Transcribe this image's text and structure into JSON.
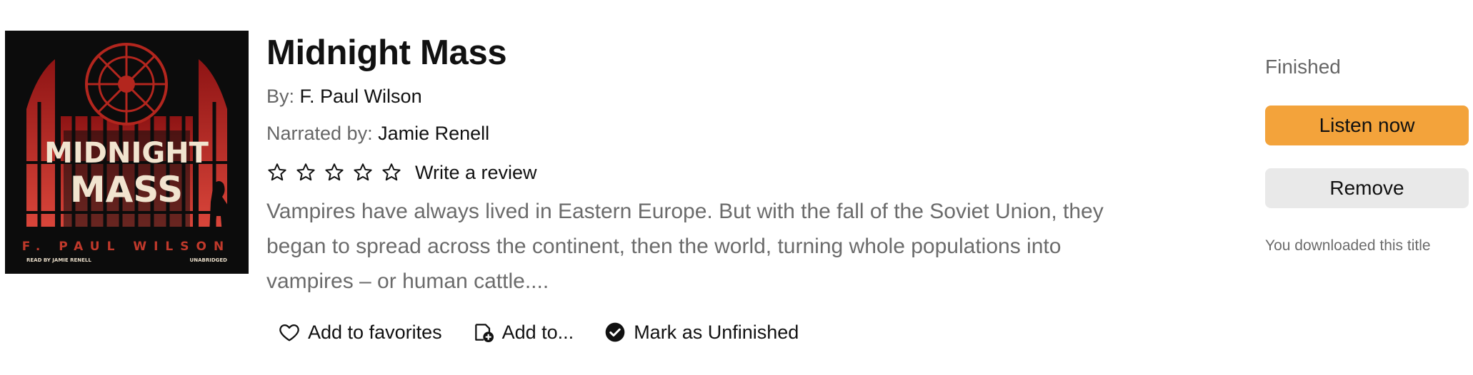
{
  "book": {
    "title": "Midnight Mass",
    "author_label": "By:",
    "author": "F. Paul Wilson",
    "narrator_label": "Narrated by:",
    "narrator": "Jamie Renell",
    "rating": {
      "stars_filled": 0,
      "stars_total": 5,
      "write_review_label": "Write a review"
    },
    "summary": "Vampires have always lived in Eastern Europe. But with the fall of the Soviet Union, they began to spread across the continent, then the world, turning whole populations into vampires – or human cattle....",
    "cover": {
      "title_line1": "MIDNIGHT",
      "title_line2": "MASS",
      "author_line": "F. PAUL WILSON",
      "narrator_line": "READ BY JAMIE RENELL",
      "edition": "UNABRIDGED"
    }
  },
  "actions": {
    "favorites_label": "Add to favorites",
    "add_to_label": "Add to...",
    "mark_unfinished_label": "Mark as Unfinished"
  },
  "side": {
    "status": "Finished",
    "listen_label": "Listen now",
    "remove_label": "Remove",
    "download_note": "You downloaded this title"
  },
  "colors": {
    "accent": "#f3a33b",
    "secondary_button": "#e9e9e9",
    "muted_text": "#6b6b6b",
    "cover_red": "#c0392b"
  },
  "icons": [
    "star-icon",
    "heart-icon",
    "add-to-list-icon",
    "check-circle-icon"
  ]
}
